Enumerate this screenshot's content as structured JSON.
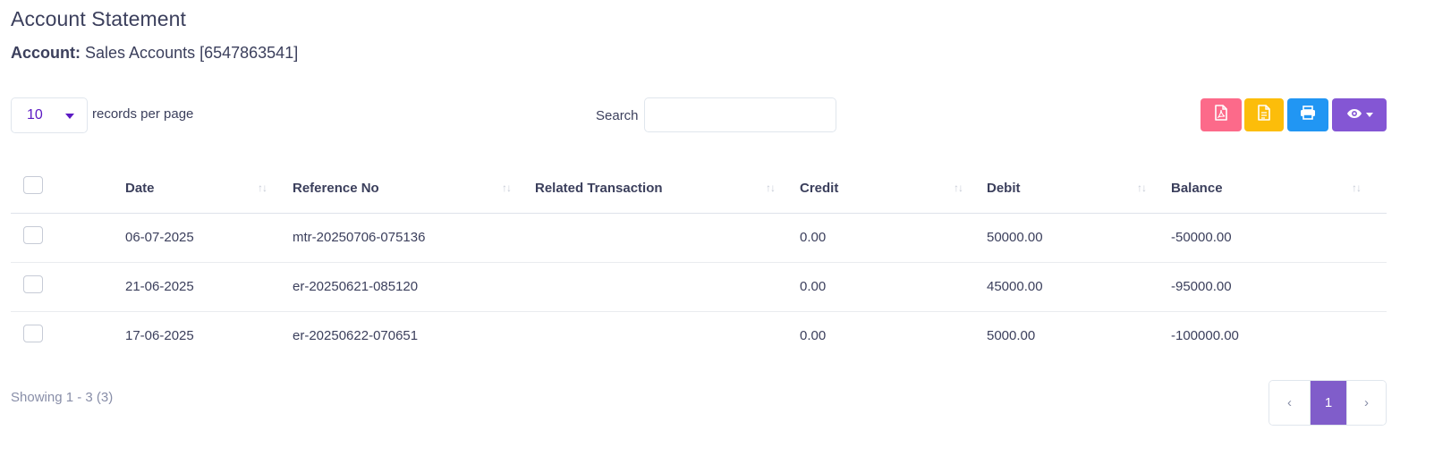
{
  "page": {
    "title": "Account Statement",
    "account_label": "Account:",
    "account_value": "Sales Accounts [6547863541]"
  },
  "controls": {
    "page_length": "10",
    "records_label": "records per page",
    "search_label": "Search",
    "search_value": ""
  },
  "toolbar": {
    "buttons": [
      {
        "name": "pdf-export-button",
        "icon": "pdf-file-icon",
        "color": "#fc6a8a"
      },
      {
        "name": "csv-export-button",
        "icon": "document-icon",
        "color": "#fcbd0a"
      },
      {
        "name": "print-button",
        "icon": "printer-icon",
        "color": "#2196f3"
      },
      {
        "name": "column-visibility-button",
        "icon": "eye-icon",
        "color": "#8456d4"
      }
    ]
  },
  "table": {
    "columns": [
      "Date",
      "Reference No",
      "Related Transaction",
      "Credit",
      "Debit",
      "Balance"
    ],
    "sort_glyph": "↑↓",
    "rows": [
      {
        "date": "06-07-2025",
        "ref": "mtr-20250706-075136",
        "related": "",
        "credit": "0.00",
        "debit": "50000.00",
        "balance": "-50000.00"
      },
      {
        "date": "21-06-2025",
        "ref": "er-20250621-085120",
        "related": "",
        "credit": "0.00",
        "debit": "45000.00",
        "balance": "-95000.00"
      },
      {
        "date": "17-06-2025",
        "ref": "er-20250622-070651",
        "related": "",
        "credit": "0.00",
        "debit": "5000.00",
        "balance": "-100000.00"
      }
    ]
  },
  "footer": {
    "info": "Showing 1 - 3 (3)",
    "pagination": {
      "prev": "‹",
      "current": "1",
      "next": "›"
    }
  },
  "colors": {
    "accent": "#805dca",
    "text": "#3b3f5c",
    "muted": "#888ea8"
  }
}
